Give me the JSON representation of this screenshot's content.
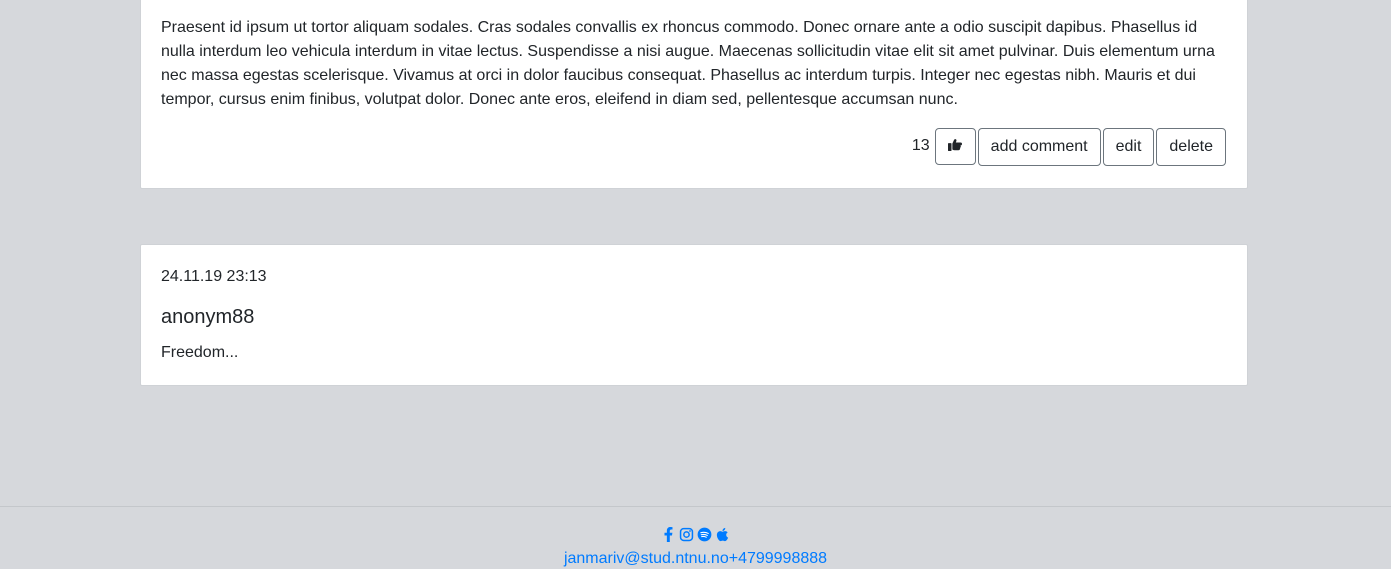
{
  "posts": [
    {
      "text": "Praesent id ipsum ut tortor aliquam sodales. Cras sodales convallis ex rhoncus commodo. Donec ornare ante a odio suscipit dapibus. Phasellus id nulla interdum leo vehicula interdum in vitae lectus. Suspendisse a nisi augue. Maecenas sollicitudin vitae elit sit amet pulvinar. Duis elementum urna nec massa egestas scelerisque. Vivamus at orci in dolor faucibus consequat. Phasellus ac interdum turpis. Integer nec egestas nibh. Mauris et dui tempor, cursus enim finibus, volutpat dolor. Donec ante eros, eleifend in diam sed, pellentesque accumsan nunc.",
      "likes": "13",
      "like_icon": "thumbs-up-icon",
      "actions": {
        "add_comment": "add comment",
        "edit": "edit",
        "delete": "delete"
      }
    },
    {
      "date": "24.11.19 23:13",
      "author": "anonym88",
      "body": "Freedom..."
    }
  ],
  "footer": {
    "social_icons": [
      "facebook-icon",
      "instagram-icon",
      "spotify-icon",
      "apple-icon"
    ],
    "email": "janmariv@stud.ntnu.no",
    "phone": "+4799998888"
  },
  "colors": {
    "background": "#d6d8dc",
    "card": "#ffffff",
    "link": "#007bff",
    "button_border": "#6c757d"
  }
}
